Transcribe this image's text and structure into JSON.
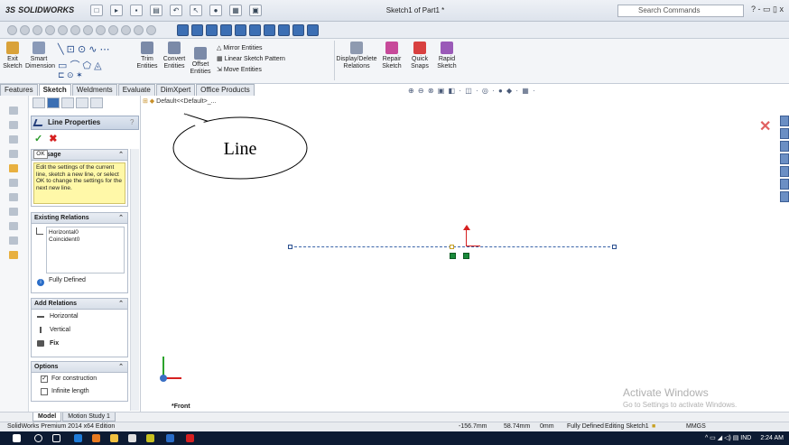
{
  "app": {
    "logo": "SOLIDWORKS",
    "logo_prefix": "3S",
    "document_title": "Sketch1 of Part1 *",
    "search_placeholder": "Search Commands",
    "window_controls": "? - ▭ ▯ x"
  },
  "ribbon": {
    "buttons": [
      {
        "label": "Exit Sketch",
        "icon": "exit-sketch-icon"
      },
      {
        "label": "Smart Dimension",
        "icon": "smart-dimension-icon"
      },
      {
        "label": "Trim Entities",
        "icon": "trim-icon"
      },
      {
        "label": "Convert Entities",
        "icon": "convert-icon"
      },
      {
        "label": "Offset Entities",
        "icon": "offset-icon"
      },
      {
        "label": "Display/Delete Relations",
        "icon": "relations-icon"
      },
      {
        "label": "Repair Sketch",
        "icon": "repair-icon"
      },
      {
        "label": "Quick Snaps",
        "icon": "snaps-icon"
      },
      {
        "label": "Rapid Sketch",
        "icon": "rapid-sketch-icon"
      }
    ],
    "mirror": "Mirror Entities",
    "linear_pattern": "Linear Sketch Pattern",
    "move": "Move Entities"
  },
  "tabs": [
    "Features",
    "Sketch",
    "Weldments",
    "Evaluate",
    "DimXpert",
    "Office Products"
  ],
  "active_tab": "Sketch",
  "property_manager": {
    "title": "Line Properties",
    "help": "?",
    "ok_symbol": "✓",
    "cancel_symbol": "✖",
    "ok_tooltip": "OK",
    "message_header": "Message",
    "message": "Edit the settings of the current line, sketch a new line, or select OK to change the settings for the next new line.",
    "existing_relations_header": "Existing Relations",
    "relations": [
      "Horizontal0",
      "Coincident0"
    ],
    "status": "Fully Defined",
    "add_relations_header": "Add Relations",
    "add_relations": [
      "Horizontal",
      "Vertical",
      "Fix"
    ],
    "options_header": "Options",
    "options": [
      {
        "label": "For construction",
        "checked": true
      },
      {
        "label": "Infinite length",
        "checked": false
      }
    ]
  },
  "canvas": {
    "tree_item": "Default<<Default>_...",
    "callout": "Line",
    "view_label": "*Front",
    "watermark_title": "Activate Windows",
    "watermark_sub": "Go to Settings to activate Windows."
  },
  "bottom_tabs": [
    "Model",
    "Motion Study 1"
  ],
  "status_bar": {
    "edition": "SolidWorks Premium 2014 x64 Edition",
    "x": "-156.7mm",
    "y": "58.74mm",
    "z": "0mm",
    "state": "Fully Defined",
    "editing": "Editing Sketch1",
    "units": "MMGS"
  },
  "taskbar": {
    "lang": "IND",
    "time": "2:24 AM"
  },
  "colors": {
    "accent": "#3b6fb3",
    "tooltip_bg": "#fff8a8",
    "construction_line": "#3a64a8",
    "origin_red": "#d62020",
    "taskbar": "#0d1b33"
  }
}
